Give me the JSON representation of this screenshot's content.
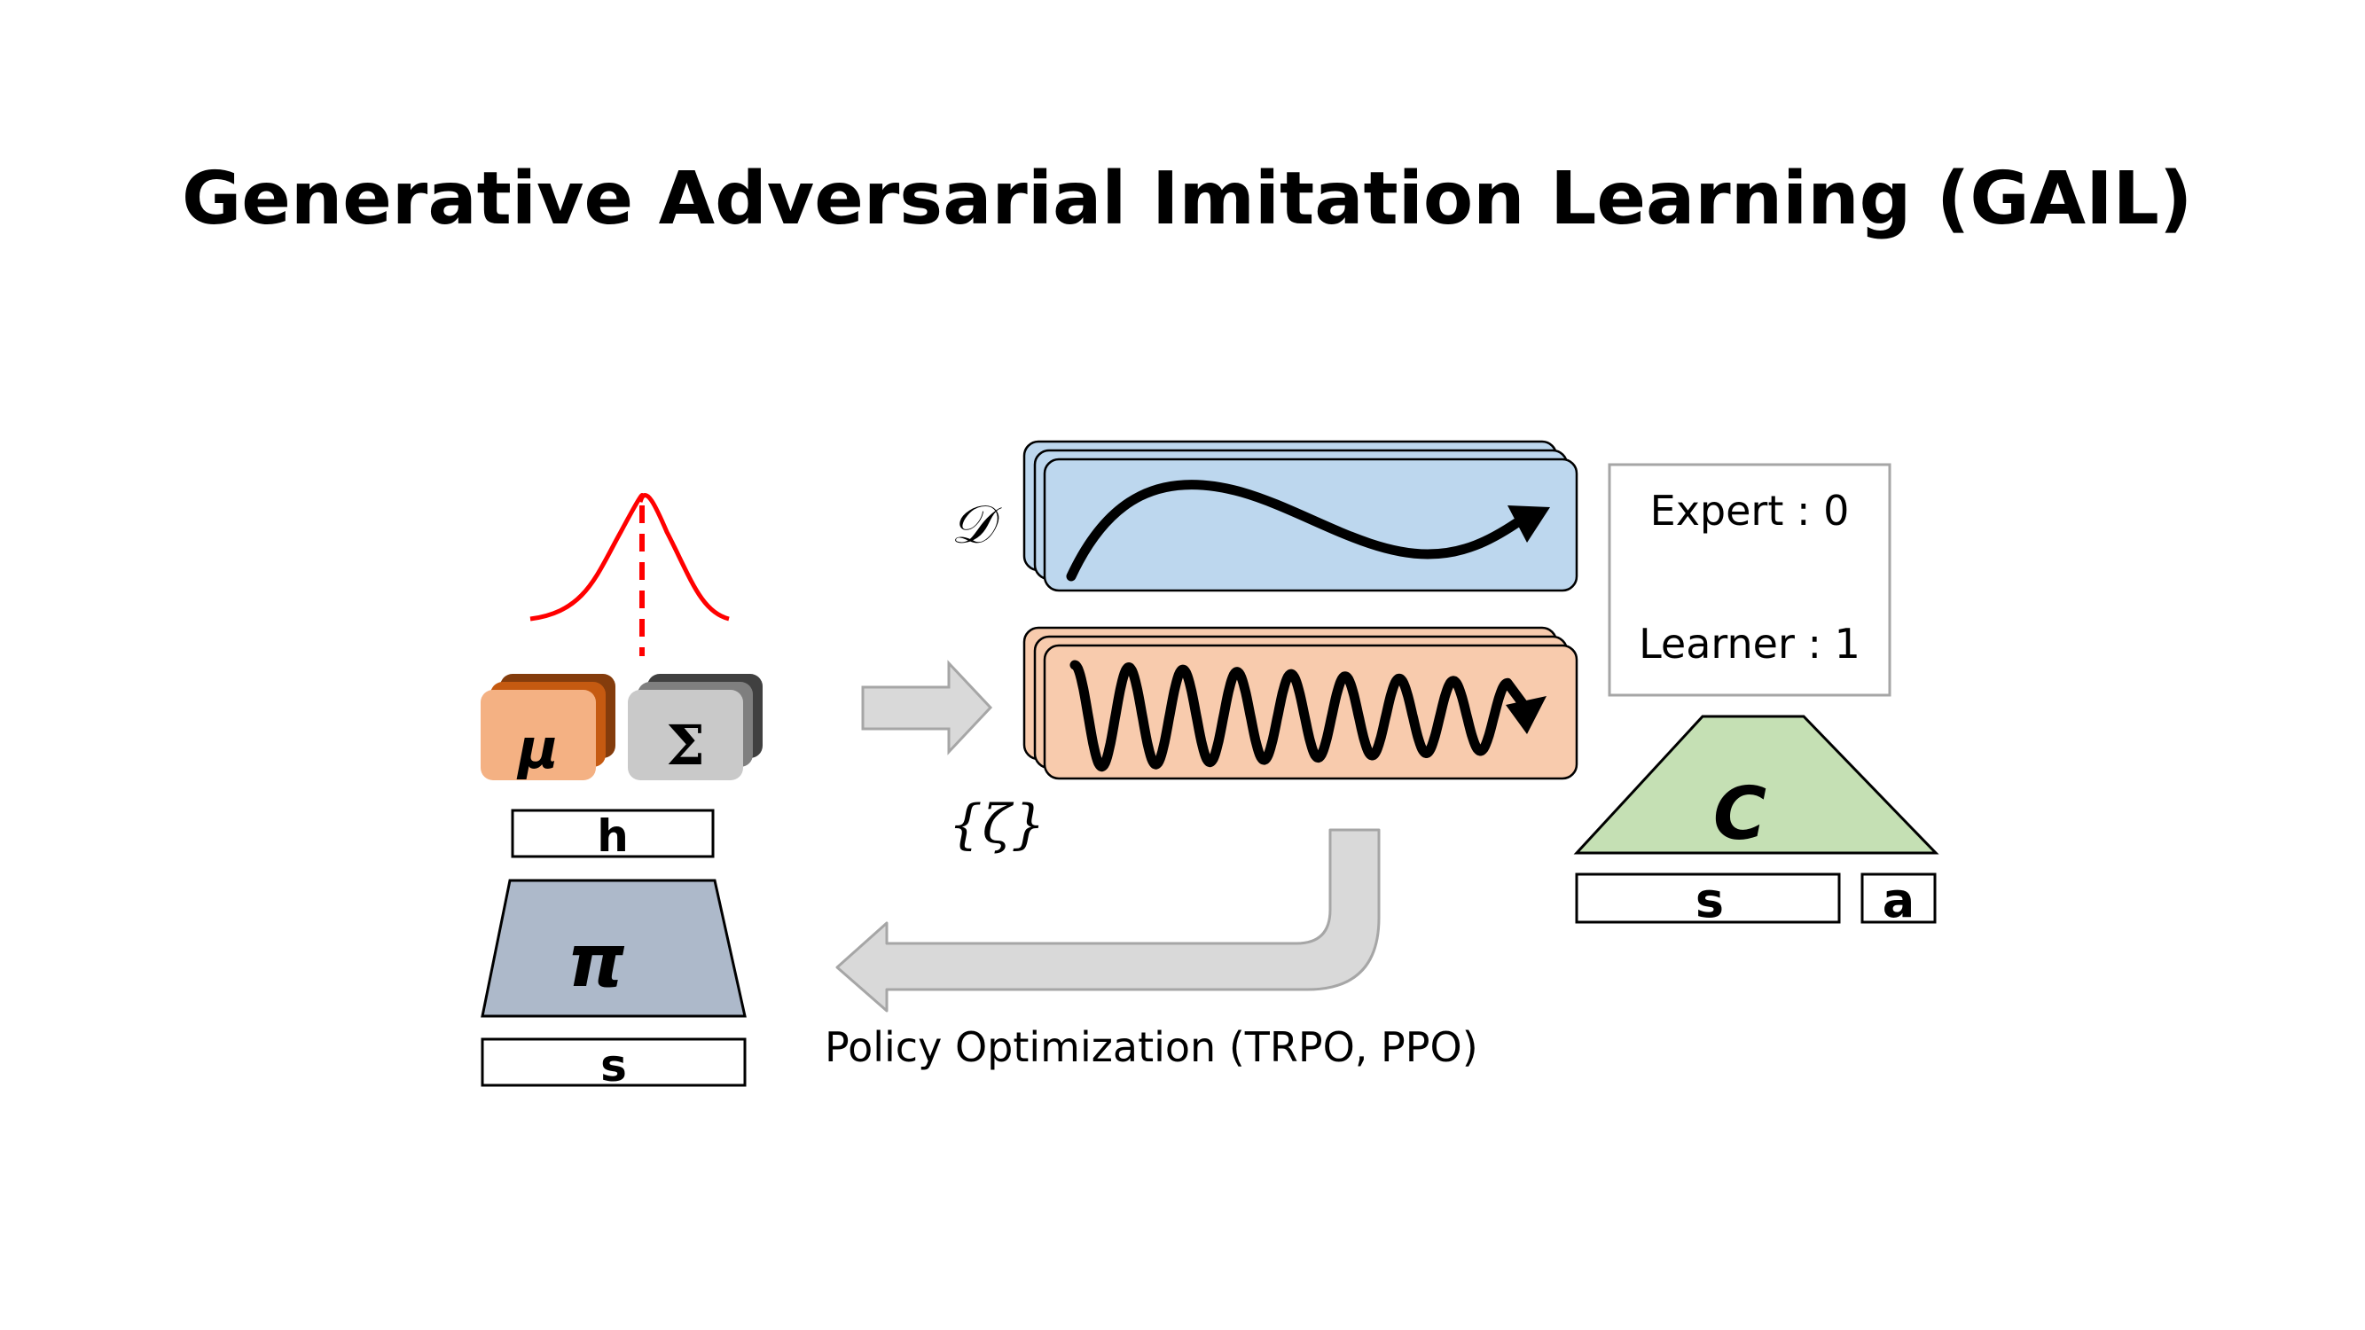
{
  "slide": {
    "title": "Generative Adversarial Imitation Learning (GAIL)"
  },
  "policy": {
    "mu_label": "μ",
    "sigma_label": "Σ",
    "hidden_label": "h",
    "pi_label": "π",
    "state_label": "s"
  },
  "trajectories": {
    "expert_label": "𝒟",
    "learner_label": "{ζ}"
  },
  "discriminator": {
    "expert_text": "Expert : 0",
    "learner_text": "Learner : 1",
    "c_label": "C",
    "state_label": "s",
    "action_label": "a"
  },
  "feedback": {
    "caption": "Policy Optimization (TRPO, PPO)"
  },
  "colors": {
    "gaussian": "#ff0000",
    "mu_fill": "#f4b183",
    "mu_shadow": "#c55a11",
    "sigma_fill": "#c9c9c9",
    "sigma_shadow": "#595959",
    "pi_fill": "#adb9ca",
    "expert_fill": "#bdd7ee",
    "learner_fill": "#f8cbad",
    "c_fill": "#c5e0b4",
    "arrow_fill": "#d9d9d9",
    "arrow_stroke": "#a6a6a6"
  }
}
